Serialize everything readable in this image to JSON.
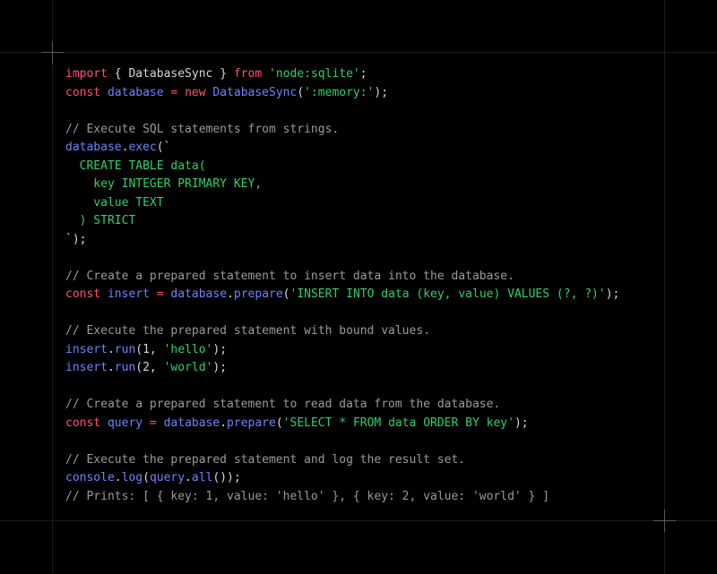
{
  "code_lines": [
    [
      {
        "t": "import",
        "c": "kw"
      },
      {
        "t": " { DatabaseSync } ",
        "c": "pl"
      },
      {
        "t": "from",
        "c": "kw"
      },
      {
        "t": " ",
        "c": "pl"
      },
      {
        "t": "'node:sqlite'",
        "c": "str"
      },
      {
        "t": ";",
        "c": "pl"
      }
    ],
    [
      {
        "t": "const",
        "c": "kw"
      },
      {
        "t": " ",
        "c": "pl"
      },
      {
        "t": "database",
        "c": "fn"
      },
      {
        "t": " = ",
        "c": "kw"
      },
      {
        "t": "new",
        "c": "kw"
      },
      {
        "t": " ",
        "c": "pl"
      },
      {
        "t": "DatabaseSync",
        "c": "fn"
      },
      {
        "t": "(",
        "c": "pl"
      },
      {
        "t": "':memory:'",
        "c": "str"
      },
      {
        "t": ");",
        "c": "pl"
      }
    ],
    [],
    [
      {
        "t": "// Execute SQL statements from strings.",
        "c": "cm"
      }
    ],
    [
      {
        "t": "database",
        "c": "fn"
      },
      {
        "t": ".",
        "c": "pl"
      },
      {
        "t": "exec",
        "c": "fn"
      },
      {
        "t": "(`",
        "c": "pl"
      }
    ],
    [
      {
        "t": "  CREATE TABLE data(",
        "c": "str"
      }
    ],
    [
      {
        "t": "    key INTEGER PRIMARY KEY,",
        "c": "str"
      }
    ],
    [
      {
        "t": "    value TEXT",
        "c": "str"
      }
    ],
    [
      {
        "t": "  ) STRICT",
        "c": "str"
      }
    ],
    [
      {
        "t": "`);",
        "c": "pl"
      }
    ],
    [],
    [
      {
        "t": "// Create a prepared statement to insert data into the database.",
        "c": "cm"
      }
    ],
    [
      {
        "t": "const",
        "c": "kw"
      },
      {
        "t": " ",
        "c": "pl"
      },
      {
        "t": "insert",
        "c": "fn"
      },
      {
        "t": " = ",
        "c": "kw"
      },
      {
        "t": "database",
        "c": "fn"
      },
      {
        "t": ".",
        "c": "pl"
      },
      {
        "t": "prepare",
        "c": "fn"
      },
      {
        "t": "(",
        "c": "pl"
      },
      {
        "t": "'INSERT INTO data (key, value) VALUES (?, ?)'",
        "c": "str"
      },
      {
        "t": ");",
        "c": "pl"
      }
    ],
    [],
    [
      {
        "t": "// Execute the prepared statement with bound values.",
        "c": "cm"
      }
    ],
    [
      {
        "t": "insert",
        "c": "fn"
      },
      {
        "t": ".",
        "c": "pl"
      },
      {
        "t": "run",
        "c": "fn"
      },
      {
        "t": "(1, ",
        "c": "pl"
      },
      {
        "t": "'hello'",
        "c": "str"
      },
      {
        "t": ");",
        "c": "pl"
      }
    ],
    [
      {
        "t": "insert",
        "c": "fn"
      },
      {
        "t": ".",
        "c": "pl"
      },
      {
        "t": "run",
        "c": "fn"
      },
      {
        "t": "(2, ",
        "c": "pl"
      },
      {
        "t": "'world'",
        "c": "str"
      },
      {
        "t": ");",
        "c": "pl"
      }
    ],
    [],
    [
      {
        "t": "// Create a prepared statement to read data from the database.",
        "c": "cm"
      }
    ],
    [
      {
        "t": "const",
        "c": "kw"
      },
      {
        "t": " ",
        "c": "pl"
      },
      {
        "t": "query",
        "c": "fn"
      },
      {
        "t": " = ",
        "c": "kw"
      },
      {
        "t": "database",
        "c": "fn"
      },
      {
        "t": ".",
        "c": "pl"
      },
      {
        "t": "prepare",
        "c": "fn"
      },
      {
        "t": "(",
        "c": "pl"
      },
      {
        "t": "'SELECT * FROM data ORDER BY key'",
        "c": "str"
      },
      {
        "t": ");",
        "c": "pl"
      }
    ],
    [],
    [
      {
        "t": "// Execute the prepared statement and log the result set.",
        "c": "cm"
      }
    ],
    [
      {
        "t": "console",
        "c": "fn"
      },
      {
        "t": ".",
        "c": "pl"
      },
      {
        "t": "log",
        "c": "fn"
      },
      {
        "t": "(",
        "c": "pl"
      },
      {
        "t": "query",
        "c": "fn"
      },
      {
        "t": ".",
        "c": "pl"
      },
      {
        "t": "all",
        "c": "fn"
      },
      {
        "t": "());",
        "c": "pl"
      }
    ],
    [
      {
        "t": "// Prints: [ { key: 1, value: 'hello' }, { key: 2, value: 'world' } ]",
        "c": "cm"
      }
    ]
  ],
  "colors": {
    "background": "#000000",
    "keyword": "#ff4f78",
    "identifier": "#6d83ff",
    "string": "#2fd06a",
    "comment": "#9a9a9a",
    "plain": "#d6d6d6"
  }
}
